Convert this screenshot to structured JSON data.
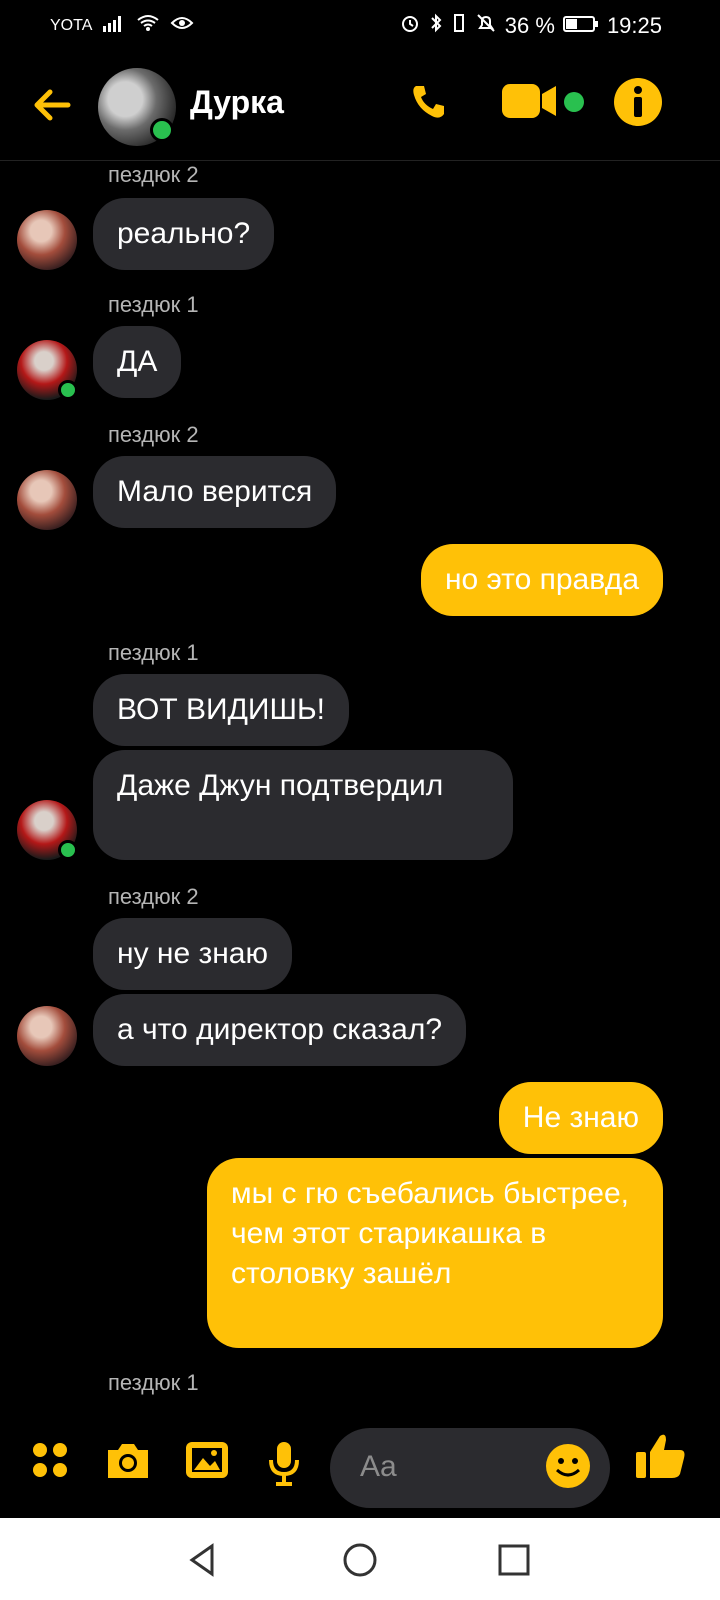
{
  "status_bar": {
    "carrier": "YOTA",
    "battery": "36 %",
    "time": "19:25"
  },
  "header": {
    "title": "Дурка",
    "accent_color": "#ffc107",
    "icons": [
      "back-arrow-icon",
      "phone-icon",
      "video-icon",
      "info-icon"
    ]
  },
  "messages": [
    {
      "sender": "пездюк 2",
      "text": "реально?"
    },
    {
      "sender": "пездюк 1",
      "text": "ДА"
    },
    {
      "sender": "пездюк 2",
      "text": "Мало верится"
    },
    {
      "sender": "me",
      "text": "но это правда"
    },
    {
      "sender": "пездюк 1",
      "text": "ВОТ ВИДИШЬ!"
    },
    {
      "sender": "пездюк 1",
      "text": "Даже Джун подтвердил"
    },
    {
      "sender": "пездюк 2",
      "text": "ну не знаю"
    },
    {
      "sender": "пездюк 2",
      "text": "а что директор сказал?"
    },
    {
      "sender": "me",
      "text": "Не знаю"
    },
    {
      "sender": "me",
      "text": "мы с гю съебались быстрее, чем этот старикашка в столовку зашёл"
    },
    {
      "sender": "пездюк 1",
      "text": ""
    }
  ],
  "labels": {
    "sender_2": "пездюк 2",
    "sender_1": "пездюк 1"
  },
  "composer": {
    "placeholder": "Aa",
    "icons": [
      "apps-icon",
      "camera-icon",
      "gallery-icon",
      "microphone-icon",
      "emoji-icon",
      "thumbs-up-icon"
    ]
  }
}
